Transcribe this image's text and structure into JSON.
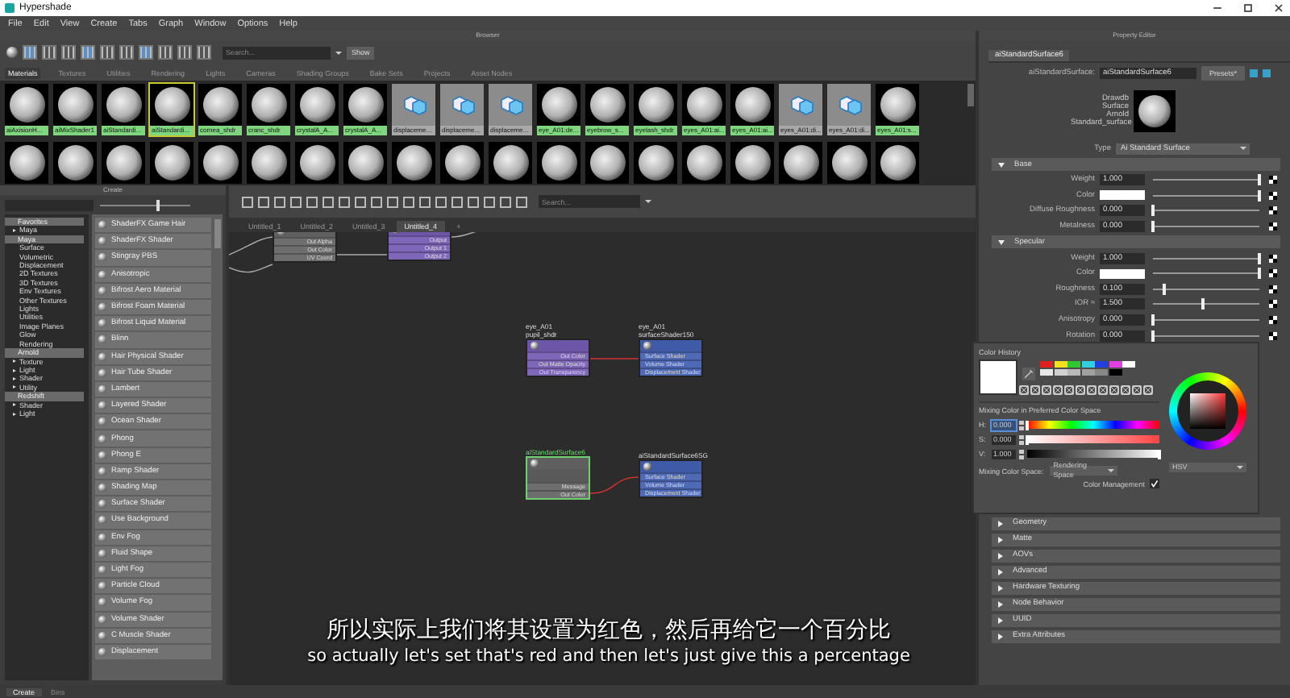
{
  "window": {
    "title": "Hypershade"
  },
  "menu": [
    "File",
    "Edit",
    "View",
    "Create",
    "Tabs",
    "Graph",
    "Window",
    "Options",
    "Help"
  ],
  "browser": {
    "title": "Browser",
    "search": {
      "placeholder": "Search..."
    },
    "show_button": "Show",
    "tabs": [
      {
        "label": "Materials",
        "selected": true
      },
      {
        "label": "Textures",
        "selected": false
      },
      {
        "label": "Utilities",
        "selected": false
      },
      {
        "label": "Rendering",
        "selected": false
      },
      {
        "label": "Lights",
        "selected": false
      },
      {
        "label": "Cameras",
        "selected": false
      },
      {
        "label": "Shading Groups",
        "selected": false
      },
      {
        "label": "Bake Sets",
        "selected": false
      },
      {
        "label": "Projects",
        "selected": false
      },
      {
        "label": "Asset Nodes",
        "selected": false
      }
    ],
    "swatches": [
      {
        "label": "aiAxisionH...",
        "kind": "sphere",
        "selected": false
      },
      {
        "label": "aiMixShader1",
        "kind": "sphere",
        "selected": false
      },
      {
        "label": "aiStandardi...",
        "kind": "sphere",
        "selected": false
      },
      {
        "label": "aiStandardi...",
        "kind": "sphere",
        "selected": true
      },
      {
        "label": "cornea_shdr",
        "kind": "sphere",
        "selected": false
      },
      {
        "label": "cranc_shdr",
        "kind": "sphere",
        "selected": false
      },
      {
        "label": "crystalA_A...",
        "kind": "sphere",
        "selected": false
      },
      {
        "label": "crystalA_A...",
        "kind": "sphere",
        "selected": false
      },
      {
        "label": "displaceme...",
        "kind": "displacement",
        "selected": false
      },
      {
        "label": "displaceme...",
        "kind": "displacement",
        "selected": false
      },
      {
        "label": "displaceme...",
        "kind": "displacement",
        "selected": false
      },
      {
        "label": "eye_A01:de...",
        "kind": "sphere",
        "selected": false
      },
      {
        "label": "eyebrow_s...",
        "kind": "sphere",
        "selected": false
      },
      {
        "label": "eyelash_shdr",
        "kind": "sphere",
        "selected": false
      },
      {
        "label": "eyes_A01:ai...",
        "kind": "sphere",
        "selected": false
      },
      {
        "label": "eyes_A01:ai...",
        "kind": "sphere",
        "selected": false
      },
      {
        "label": "eyes_A01:di...",
        "kind": "displacement",
        "selected": false
      },
      {
        "label": "eyes_A01:di...",
        "kind": "displacement",
        "selected": false
      },
      {
        "label": "eyes_A01:s...",
        "kind": "sphere",
        "selected": false
      }
    ],
    "swatches_row_2": [
      {
        "kind": "sphere"
      },
      {
        "kind": "sphere"
      },
      {
        "kind": "sphere"
      },
      {
        "kind": "sphere"
      },
      {
        "kind": "sphere"
      },
      {
        "kind": "sphere"
      },
      {
        "kind": "sphere"
      },
      {
        "kind": "sphere"
      },
      {
        "kind": "sphere"
      },
      {
        "kind": "sphere"
      },
      {
        "kind": "sphere"
      },
      {
        "kind": "sphere"
      },
      {
        "kind": "sphere"
      },
      {
        "kind": "sphere"
      },
      {
        "kind": "sphere"
      },
      {
        "kind": "sphere"
      },
      {
        "kind": "sphere"
      },
      {
        "kind": "sphere"
      },
      {
        "kind": "sphere"
      }
    ]
  },
  "create_panel": {
    "title": "Create",
    "slider": {
      "level": 0.62
    },
    "tree": [
      {
        "label": "Favorites",
        "children": [
          {
            "label": "Maya"
          }
        ]
      },
      {
        "label": "Maya",
        "children": [
          {
            "label": "Surface"
          },
          {
            "label": "Volumetric"
          },
          {
            "label": "Displacement"
          },
          {
            "label": "2D Textures"
          },
          {
            "label": "3D Textures"
          },
          {
            "label": "Env Textures"
          },
          {
            "label": "Other Textures"
          },
          {
            "label": "Lights"
          },
          {
            "label": "Utilities"
          },
          {
            "label": "Image Planes"
          },
          {
            "label": "Glow"
          },
          {
            "label": "Rendering"
          }
        ]
      },
      {
        "label": "Arnold",
        "children": [
          {
            "label": "Texture"
          },
          {
            "label": "Light"
          },
          {
            "label": "Shader"
          },
          {
            "label": "Utility"
          }
        ]
      },
      {
        "label": "Redshift",
        "children": [
          {
            "label": "Shader"
          },
          {
            "label": "Light"
          }
        ]
      }
    ],
    "items": [
      "ShaderFX Game Hair",
      "ShaderFX Shader",
      "Stingray PBS",
      "Anisotropic",
      "Bifrost Aero Material",
      "Bifrost Foam Material",
      "Bifrost Liquid Material",
      "Blinn",
      "Hair Physical Shader",
      "Hair Tube Shader",
      "Lambert",
      "Layered Shader",
      "Ocean Shader",
      "Phong",
      "Phong E",
      "Ramp Shader",
      "Shading Map",
      "Surface Shader",
      "Use Background",
      "Env Fog",
      "Fluid Shape",
      "Light Fog",
      "Particle Cloud",
      "Volume Fog",
      "Volume Shader",
      "C Muscle Shader",
      "Displacement"
    ],
    "bottom_tabs": [
      {
        "label": "Create",
        "selected": true
      },
      {
        "label": "Bins",
        "selected": false
      }
    ]
  },
  "node_editor": {
    "search": {
      "placeholder": "Search..."
    },
    "tabs": [
      {
        "label": "Untitled_1",
        "selected": false
      },
      {
        "label": "Untitled_2",
        "selected": false
      },
      {
        "label": "Untitled_3",
        "selected": false
      },
      {
        "label": "Untitled_4",
        "selected": true
      },
      {
        "label": "+",
        "selected": false
      }
    ],
    "nodes": [
      {
        "kind": "utility",
        "selected": false,
        "ports": [
          "Out Alpha",
          "Out Color",
          "UV Coord"
        ]
      },
      {
        "kind": "texture",
        "selected": false,
        "ports": [
          "Output",
          "Output 1",
          "Output 2"
        ]
      },
      {
        "labels": [
          "eye_A01",
          "pupil_shdr"
        ],
        "kind": "texture",
        "selected": false,
        "ports": [
          "Out Color",
          "Out Matte Opacity",
          "Out Transparency"
        ]
      },
      {
        "labels": [
          "eye_A01",
          "surfaceShader150"
        ],
        "kind": "sg",
        "selected": false,
        "ports": [
          "Surface Shader",
          "Volume Shader",
          "Displacement Shader"
        ]
      },
      {
        "labels": [
          "aiStandardSurface6"
        ],
        "kind": "shader",
        "selected": true,
        "ports": [
          "Message",
          "Out Color"
        ]
      },
      {
        "labels": [
          "aiStandardSurface6SG"
        ],
        "kind": "sg",
        "selected": false,
        "ports": [
          "Surface Shader",
          "Volume Shader",
          "Displacement Shader"
        ]
      }
    ]
  },
  "property_editor": {
    "title": "Property Editor",
    "tab": "aiStandardSurface6",
    "node_type_label": "aiStandardSurface:",
    "node_name": "aiStandardSurface6",
    "presets_button": "Presets*",
    "classification": [
      "Drawdb",
      "Surface",
      "Arnold",
      "Standard_surface"
    ],
    "type_label": "Type",
    "type_value": "Ai Standard Surface",
    "sections": [
      {
        "title": "Base",
        "expanded": true,
        "rows": [
          {
            "label": "Weight",
            "kind": "number",
            "value": "1.000",
            "level": 1
          },
          {
            "label": "Color",
            "kind": "color",
            "color": "#ffffff",
            "level": 1
          },
          {
            "label": "Diffuse Roughness",
            "kind": "number",
            "value": "0.000",
            "level": 0
          },
          {
            "label": "Metalness",
            "kind": "number",
            "value": "0.000",
            "level": 0
          }
        ]
      },
      {
        "title": "Specular",
        "expanded": true,
        "rows": [
          {
            "label": "Weight",
            "kind": "number",
            "value": "1.000",
            "level": 1
          },
          {
            "label": "Color",
            "kind": "color",
            "color": "#ffffff",
            "level": 1
          },
          {
            "label": "Roughness",
            "kind": "number",
            "value": "0.100",
            "level": 0.1
          },
          {
            "label": "IOR ≈",
            "kind": "number",
            "value": "1.500",
            "level": 0.47
          },
          {
            "label": "Anisotropy",
            "kind": "number",
            "value": "0.000",
            "level": 0
          },
          {
            "label": "Rotation",
            "kind": "number",
            "value": "0.000",
            "level": 0
          }
        ]
      },
      {
        "title": "Geometry",
        "expanded": false
      },
      {
        "title": "Matte",
        "expanded": false
      },
      {
        "title": "AOVs",
        "expanded": false
      },
      {
        "title": "Advanced",
        "expanded": false
      },
      {
        "title": "Hardware Texturing",
        "expanded": false
      },
      {
        "title": "Node Behavior",
        "expanded": false
      },
      {
        "title": "UUID",
        "expanded": false
      },
      {
        "title": "Extra Attributes",
        "expanded": false
      }
    ]
  },
  "color_picker": {
    "title": "Color History",
    "current": {
      "color": "#ffffff"
    },
    "palette": [
      {
        "color": "#e02020"
      },
      {
        "color": "#f0e020"
      },
      {
        "color": "#30c830"
      },
      {
        "color": "#30d0e0"
      },
      {
        "color": "#2040e0"
      },
      {
        "color": "#e040e0"
      },
      {
        "color": "#ffffff"
      },
      {
        "color": "#e8e8e8"
      },
      {
        "color": "#d0d0d0"
      },
      {
        "color": "#b8b8b8"
      },
      {
        "color": "#a0a0a0"
      },
      {
        "color": "#888888"
      },
      {
        "color": "#000000"
      }
    ],
    "mixing_title": "Mixing Color in Preferred Color Space",
    "channels": [
      {
        "label": "H:",
        "value": "0.000",
        "kind": "hue",
        "level": 0,
        "selected": true
      },
      {
        "label": "S:",
        "value": "0.000",
        "kind": "saturation",
        "level": 0,
        "selected": false
      },
      {
        "label": "V:",
        "value": "1.000",
        "kind": "value",
        "level": 1,
        "selected": false
      }
    ],
    "mixing_space_label": "Mixing Color Space:",
    "mixing_space": "Rendering Space",
    "color_management": {
      "label": "Color Management",
      "checked": true
    },
    "wheel_mode": "HSV"
  },
  "subtitle": {
    "zh": "所以实际上我们将其设置为红色，然后再给它一个百分比",
    "en": "so actually let's set that's red and then let's just give this a percentage"
  }
}
